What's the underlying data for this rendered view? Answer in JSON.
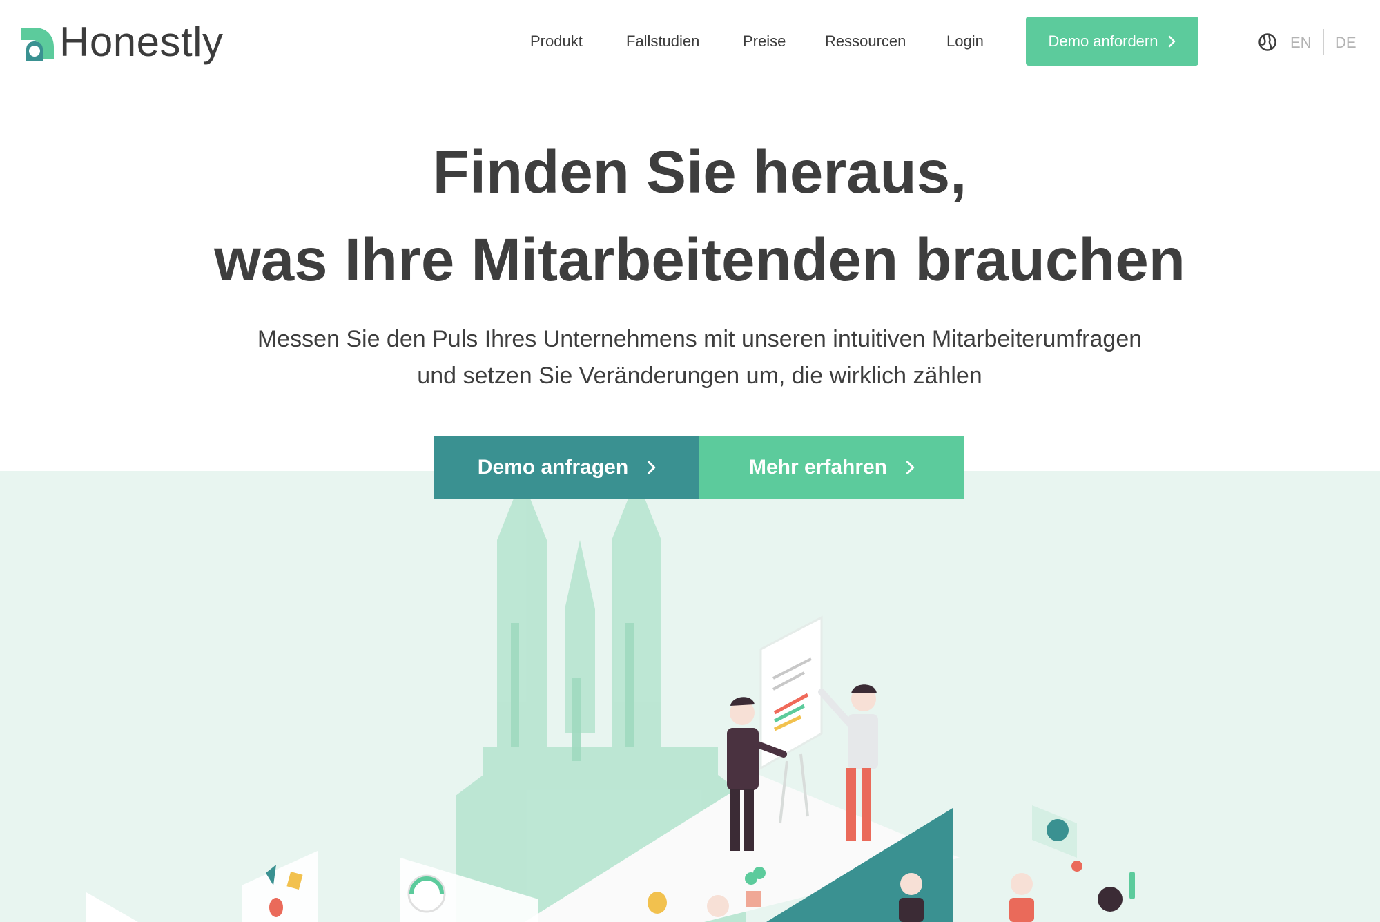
{
  "header": {
    "logo_text": "Honestly",
    "nav": [
      {
        "label": "Produkt"
      },
      {
        "label": "Fallstudien"
      },
      {
        "label": "Preise"
      },
      {
        "label": "Ressourcen"
      },
      {
        "label": "Login"
      }
    ],
    "demo_button": "Demo anfordern",
    "languages": [
      "EN",
      "DE"
    ]
  },
  "hero": {
    "title_line1": "Finden Sie heraus,",
    "title_line2": "was Ihre Mitarbeitenden brauchen",
    "subtitle_line1": "Messen Sie den Puls Ihres Unternehmens mit unseren intuitiven Mitarbeiterumfragen",
    "subtitle_line2": "und setzen Sie Veränderungen um, die wirklich zählen",
    "cta_primary": "Demo anfragen",
    "cta_secondary": "Mehr erfahren"
  },
  "colors": {
    "accent_green": "#5ccb9c",
    "accent_teal": "#3a9191",
    "band_background": "#e8f5f0",
    "text_dark": "#3e3e3e",
    "lang_muted": "#b3b3b3"
  },
  "icons": {
    "logo": "honestly-logo-mark",
    "globe": "globe-icon",
    "chevron": "chevron-right-icon"
  }
}
